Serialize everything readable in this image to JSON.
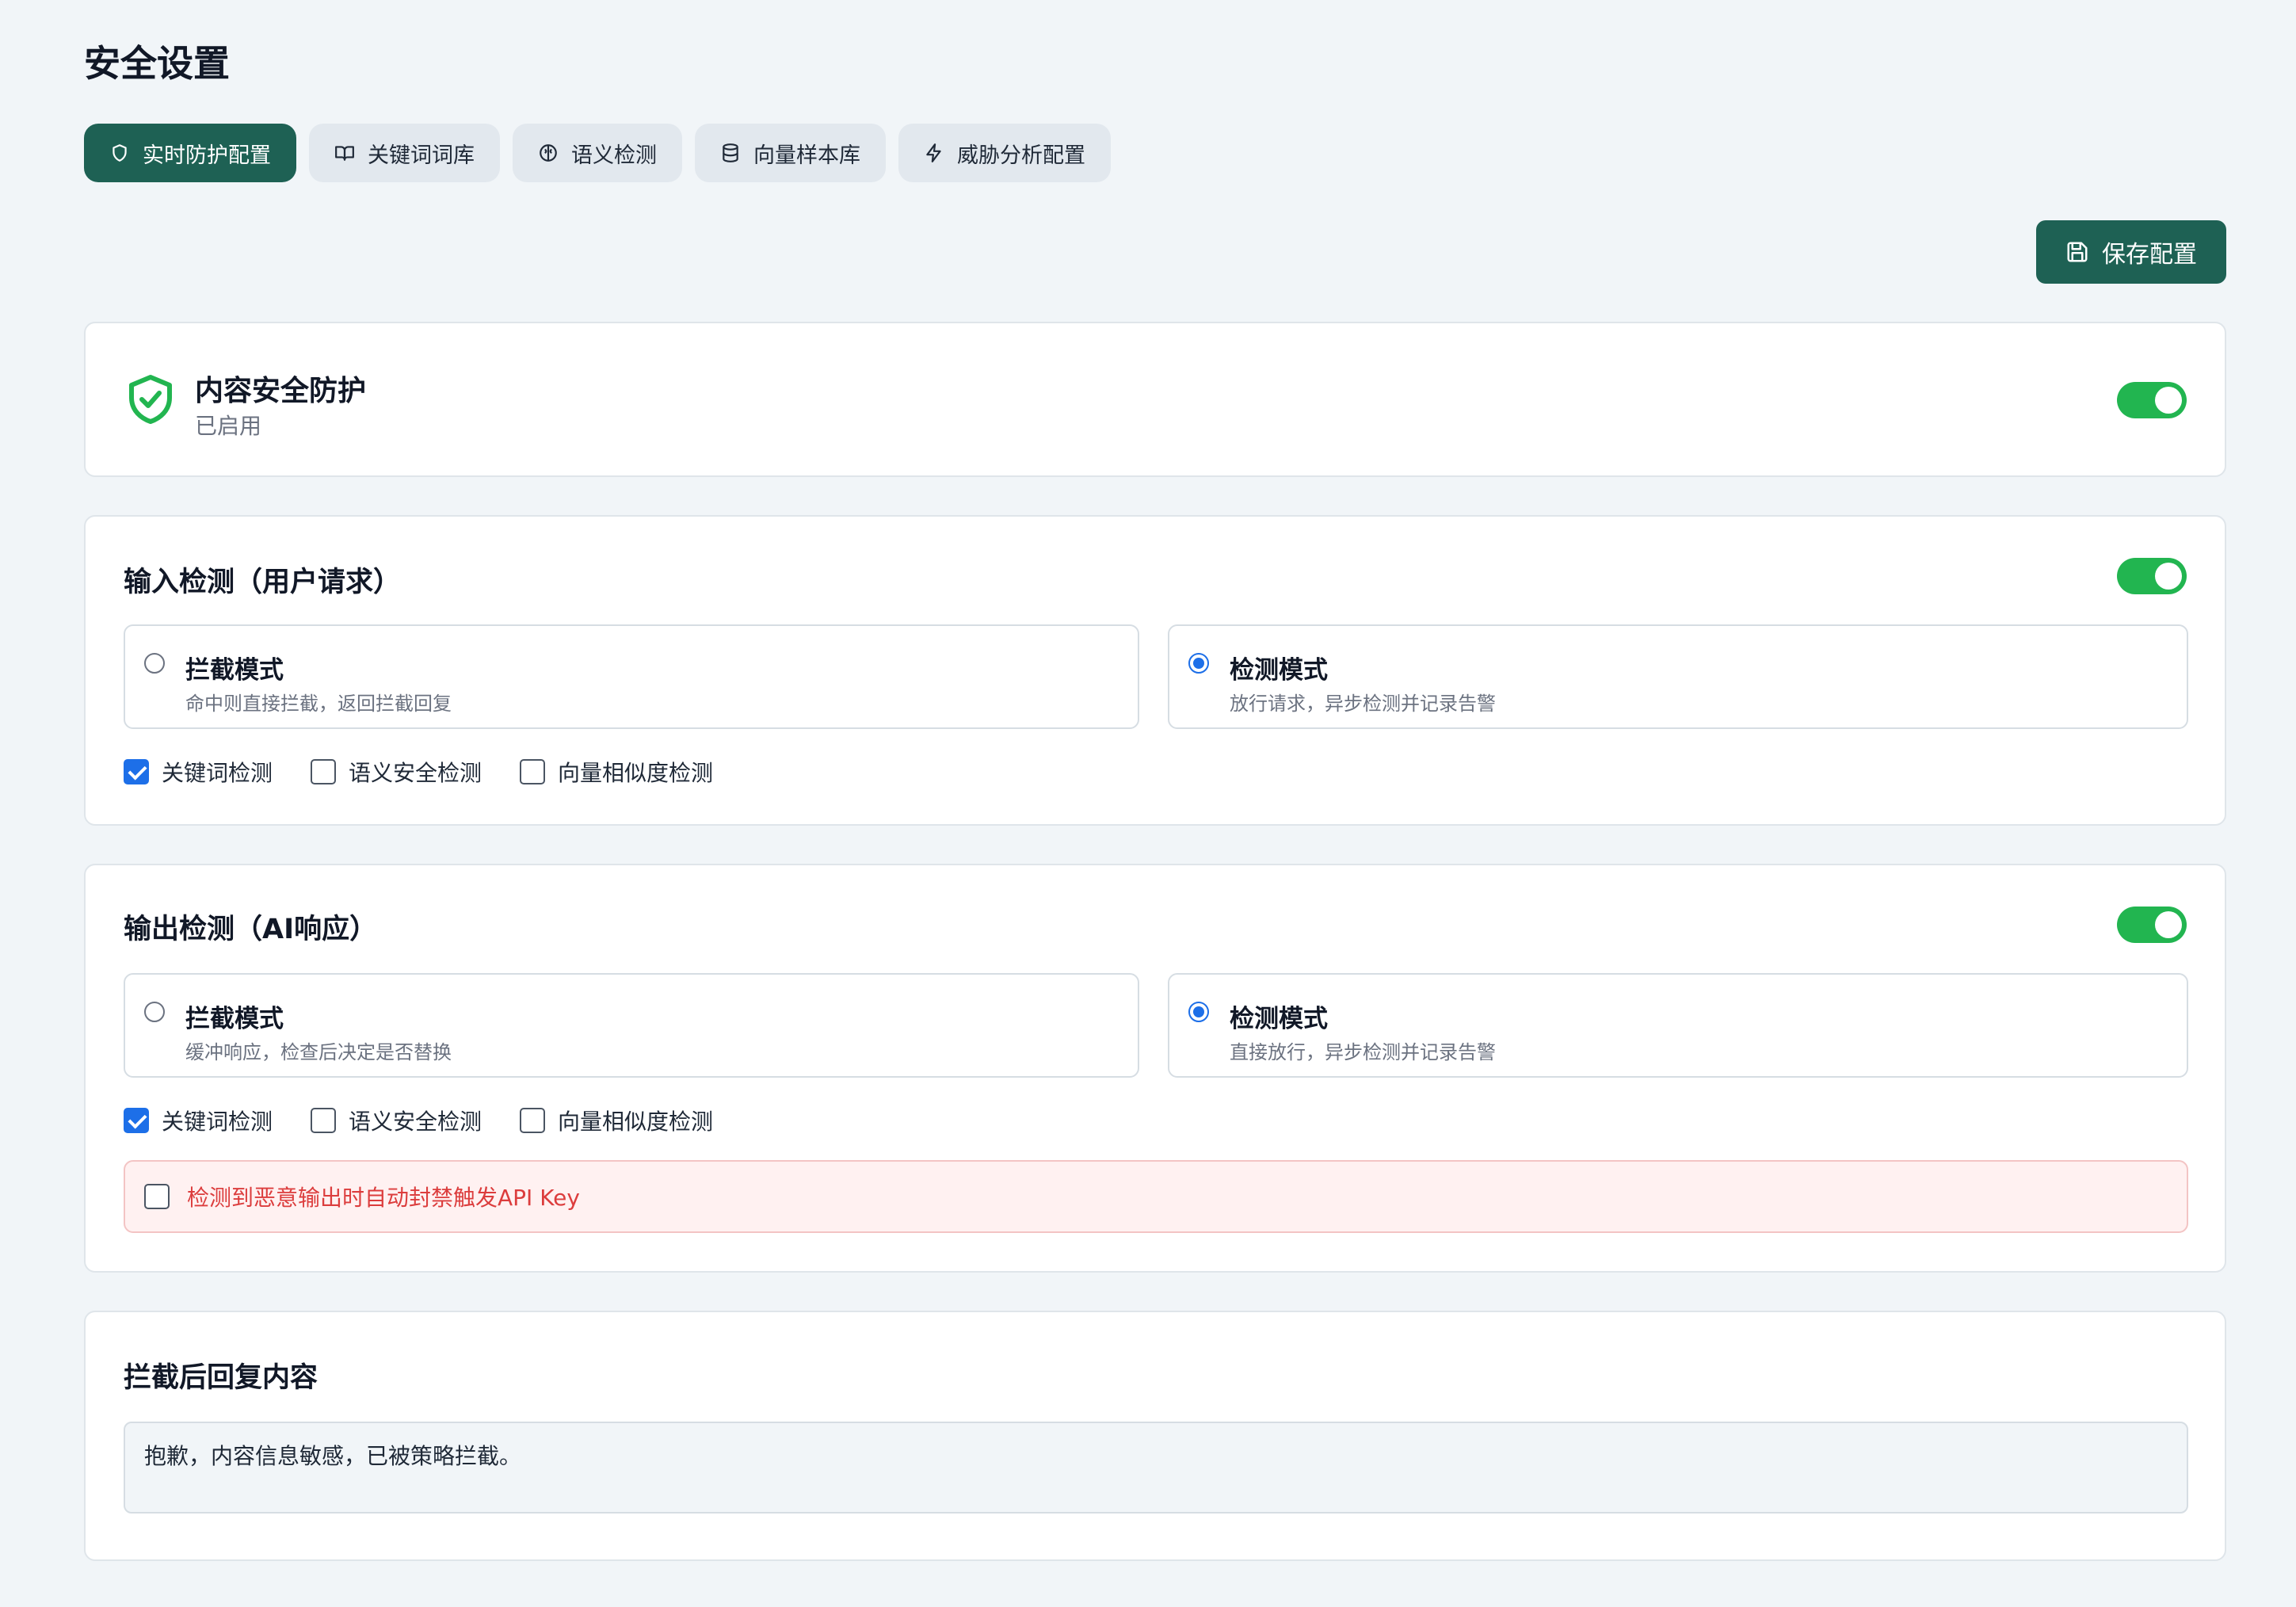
{
  "page": {
    "title": "安全设置"
  },
  "tabs": [
    {
      "label": "实时防护配置",
      "icon": "shield-icon",
      "active": true
    },
    {
      "label": "关键词词库",
      "icon": "book-icon",
      "active": false
    },
    {
      "label": "语义检测",
      "icon": "brain-icon",
      "active": false
    },
    {
      "label": "向量样本库",
      "icon": "database-icon",
      "active": false
    },
    {
      "label": "威胁分析配置",
      "icon": "lightning-icon",
      "active": false
    }
  ],
  "toolbar": {
    "save_label": "保存配置",
    "save_icon": "save-icon"
  },
  "protection": {
    "title": "内容安全防护",
    "status": "已启用",
    "enabled": true,
    "icon": "shield-check-icon",
    "icon_color": "#22b550"
  },
  "input_detection": {
    "title": "输入检测（用户请求）",
    "enabled": true,
    "modes": [
      {
        "title": "拦截模式",
        "desc": "命中则直接拦截，返回拦截回复",
        "selected": false
      },
      {
        "title": "检测模式",
        "desc": "放行请求，异步检测并记录告警",
        "selected": true
      }
    ],
    "checks": [
      {
        "label": "关键词检测",
        "checked": true
      },
      {
        "label": "语义安全检测",
        "checked": false
      },
      {
        "label": "向量相似度检测",
        "checked": false
      }
    ]
  },
  "output_detection": {
    "title": "输出检测（AI响应）",
    "enabled": true,
    "modes": [
      {
        "title": "拦截模式",
        "desc": "缓冲响应，检查后决定是否替换",
        "selected": false
      },
      {
        "title": "检测模式",
        "desc": "直接放行，异步检测并记录告警",
        "selected": true
      }
    ],
    "checks": [
      {
        "label": "关键词检测",
        "checked": true
      },
      {
        "label": "语义安全检测",
        "checked": false
      },
      {
        "label": "向量相似度检测",
        "checked": false
      }
    ],
    "ban_option": {
      "label": "检测到恶意输出时自动封禁触发API Key",
      "checked": false
    }
  },
  "reply": {
    "title": "拦截后回复内容",
    "value": "抱歉，内容信息敏感，已被策略拦截。"
  },
  "colors": {
    "primary": "#1e6154",
    "toggle_on": "#22b550",
    "checkbox_accent": "#1d6fe8",
    "danger_text": "#dc3d3d",
    "danger_bg": "#fff1f1"
  }
}
